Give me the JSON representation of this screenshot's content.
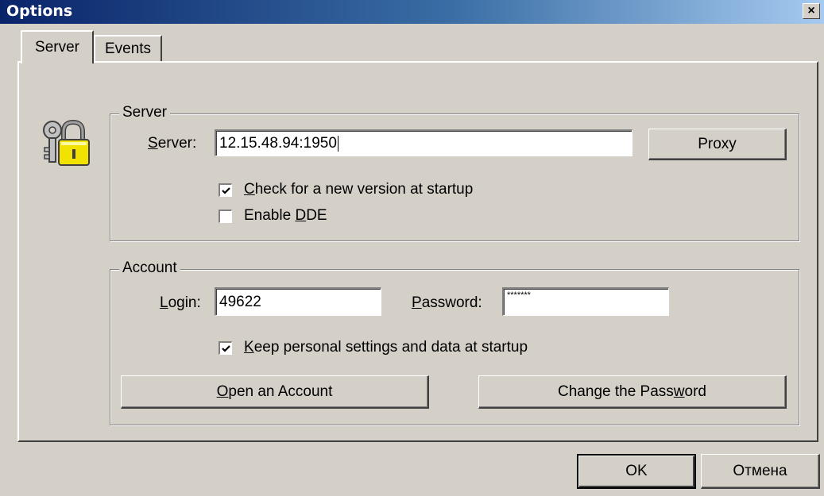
{
  "window": {
    "title": "Options",
    "close_glyph": "×"
  },
  "tabs": [
    {
      "label": "Server",
      "active": true
    },
    {
      "label": "Events",
      "active": false
    }
  ],
  "icons": {
    "header": "keys-lock-icon"
  },
  "server_group": {
    "title": "Server",
    "server_label_pre": "",
    "server_label_mnemonic": "S",
    "server_label_post": "erver:",
    "server_value": "12.15.48.94:1950",
    "proxy_label": "Proxy",
    "check_new_version": {
      "mnemonic": "C",
      "rest": "heck for a new version at startup",
      "checked": true
    },
    "enable_dde": {
      "pre": "Enable ",
      "mnemonic": "D",
      "rest": "DE",
      "checked": false
    }
  },
  "account_group": {
    "title": "Account",
    "login_mnemonic": "L",
    "login_rest": "ogin:",
    "login_value": "49622",
    "password_mnemonic": "P",
    "password_rest": "assword:",
    "password_value": "*******",
    "keep_settings": {
      "mnemonic": "K",
      "rest": "eep personal settings and data at startup",
      "checked": true
    },
    "open_account": {
      "mnemonic": "O",
      "rest": "pen an Account"
    },
    "change_password": {
      "pre": "Change the Pass",
      "mnemonic": "w",
      "rest": "ord"
    }
  },
  "footer": {
    "ok_label": "OK",
    "cancel_label": "Отмена"
  },
  "colors": {
    "titlebar_start": "#0a246a",
    "titlebar_end": "#a6caf0",
    "face": "#d4d0c8"
  }
}
